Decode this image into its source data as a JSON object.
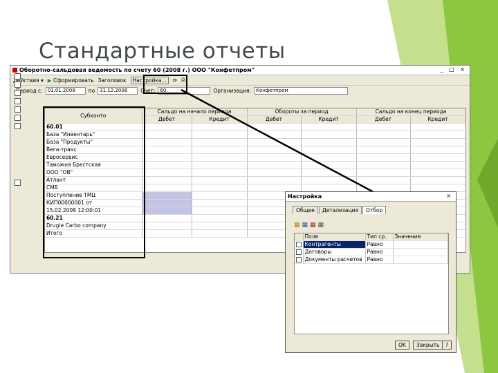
{
  "slide": {
    "title": "Стандартные отчеты"
  },
  "colors": {
    "accent_green": "#8dc63f",
    "light_green": "#c4e08e",
    "title_gray": "#414a4c",
    "selection": "#0a246a",
    "highlight": "#c3c3e4"
  },
  "main_window": {
    "title": "Оборотно-сальдовая ведомость по счету 60 (2008 г.) ООО \"Конфетпром\"",
    "controls": "_ □ ×",
    "toolbar": {
      "actions": "Действия ▾",
      "generate": "Сформировать",
      "header": "Заголовок",
      "settings": "Настройка..."
    },
    "params": {
      "period_label": "Период с:",
      "date_from": "01.01.2008",
      "to_label": "по",
      "date_to": "31.12.2008",
      "account_label": "Счет:",
      "account_value": "60",
      "org_label": "Организация:",
      "org_value": "Конфетпром"
    },
    "headers": {
      "subconto": "Субконто",
      "start_balance": "Сальдо на начало периода",
      "turnover": "Обороты за период",
      "end_balance": "Сальдо на конец периода",
      "debit": "Дебет",
      "credit": "Кредит"
    },
    "rows": [
      {
        "name": "60.01",
        "sd": "",
        "sk": "",
        "od": "",
        "ok": "",
        "ed": "",
        "ek": "",
        "bold": true
      },
      {
        "name": "База \"Инвентарь\"",
        "sd": "",
        "sk": "",
        "od": "",
        "ok": "",
        "ed": "",
        "ek": ""
      },
      {
        "name": "База \"Продукты\"",
        "sd": "",
        "sk": "",
        "od": "",
        "ok": "",
        "ed": "",
        "ek": ""
      },
      {
        "name": "Вега-транс",
        "sd": "",
        "sk": "",
        "od": "",
        "ok": "",
        "ed": "",
        "ek": ""
      },
      {
        "name": "Евросервис",
        "sd": "",
        "sk": "",
        "od": "",
        "ok": "",
        "ed": "",
        "ek": ""
      },
      {
        "name": "Таможня Брестская",
        "sd": "",
        "sk": "",
        "od": "",
        "ok": "",
        "ed": "",
        "ek": ""
      },
      {
        "name": "ООО \"ОВ\"",
        "sd": "",
        "sk": "",
        "od": "",
        "ok": "",
        "ed": "",
        "ek": ""
      },
      {
        "name": "Атлант",
        "sd": "",
        "sk": "",
        "od": "",
        "ok": "",
        "ed": "",
        "ek": ""
      },
      {
        "name": "СМБ",
        "sd": "",
        "sk": "",
        "od": "",
        "ok": "",
        "ed": "",
        "ek": ""
      },
      {
        "name": "Поступление ТМЦ",
        "sd": "",
        "sk": "",
        "od": "",
        "ok": "",
        "ed": "",
        "ek": "",
        "hl": true
      },
      {
        "name": "КИП00000001 от",
        "sd": "",
        "sk": "",
        "od": "",
        "ok": "",
        "ed": "",
        "ek": "",
        "hl": true
      },
      {
        "name": "15.02.2008 12:00:01",
        "sd": "",
        "sk": "",
        "od": "",
        "ok": "",
        "ed": "",
        "ek": "",
        "hl": true
      },
      {
        "name": "60.21",
        "sd": "",
        "sk": "",
        "od": "",
        "ok": "",
        "ed": "",
        "ek": "",
        "bold": true
      },
      {
        "name": "Drugie Carbo company",
        "sd": "",
        "sk": "",
        "od": "",
        "ok": "",
        "ed": "",
        "ek": ""
      },
      {
        "name": "Итого",
        "sd": "",
        "sk": "",
        "od": "",
        "ok": "",
        "ed": "",
        "ek": "",
        "total": true
      }
    ]
  },
  "dialog": {
    "title": "Настройка",
    "tabs": [
      "Общее",
      "Детализация",
      "Отбор"
    ],
    "active_tab": 2,
    "headers": {
      "field": "Поле",
      "type": "Тип ср.",
      "value": "Значение"
    },
    "rows": [
      {
        "field": "Контрагенты",
        "type": "Равно",
        "value": "",
        "selected": true
      },
      {
        "field": "Договоры",
        "type": "Равно",
        "value": ""
      },
      {
        "field": "Документы расчетов",
        "type": "Равно",
        "value": ""
      }
    ],
    "ok": "OK",
    "close": "Закрыть",
    "help": "?"
  }
}
